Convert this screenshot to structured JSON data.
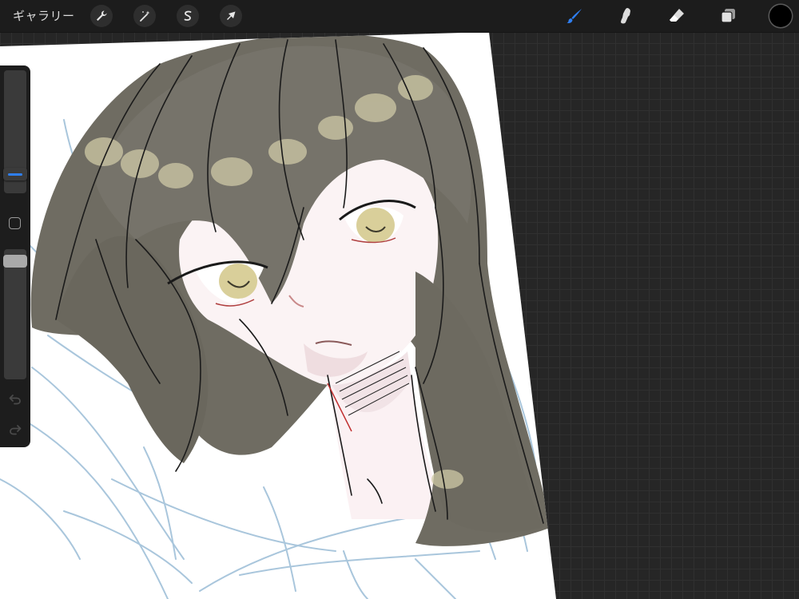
{
  "topbar": {
    "gallery_label": "ギャラリー",
    "left_tools": [
      {
        "name": "actions",
        "icon": "wrench-icon"
      },
      {
        "name": "adjustments",
        "icon": "magic-wand-icon"
      },
      {
        "name": "selection",
        "icon": "selection-s-icon"
      },
      {
        "name": "transform",
        "icon": "arrow-cursor-icon"
      }
    ],
    "right_tools": [
      {
        "name": "brush",
        "icon": "brush-icon",
        "active": true
      },
      {
        "name": "smudge",
        "icon": "smudge-icon",
        "active": false
      },
      {
        "name": "eraser",
        "icon": "eraser-icon",
        "active": false
      },
      {
        "name": "layers",
        "icon": "layers-icon",
        "active": false
      }
    ],
    "current_color": "#000000"
  },
  "sidebar": {
    "brush_size_icon": "size-slider",
    "modify_icon": "square-icon",
    "opacity_icon": "opacity-slider",
    "undo_icon": "undo-icon",
    "redo_icon": "redo-icon"
  },
  "colors": {
    "accent": "#2f7ff2",
    "hair": "#6f6c62",
    "eyes": "#d9cf9a",
    "skin": "#fbf3f4",
    "sketch": "#a9c6dc"
  }
}
